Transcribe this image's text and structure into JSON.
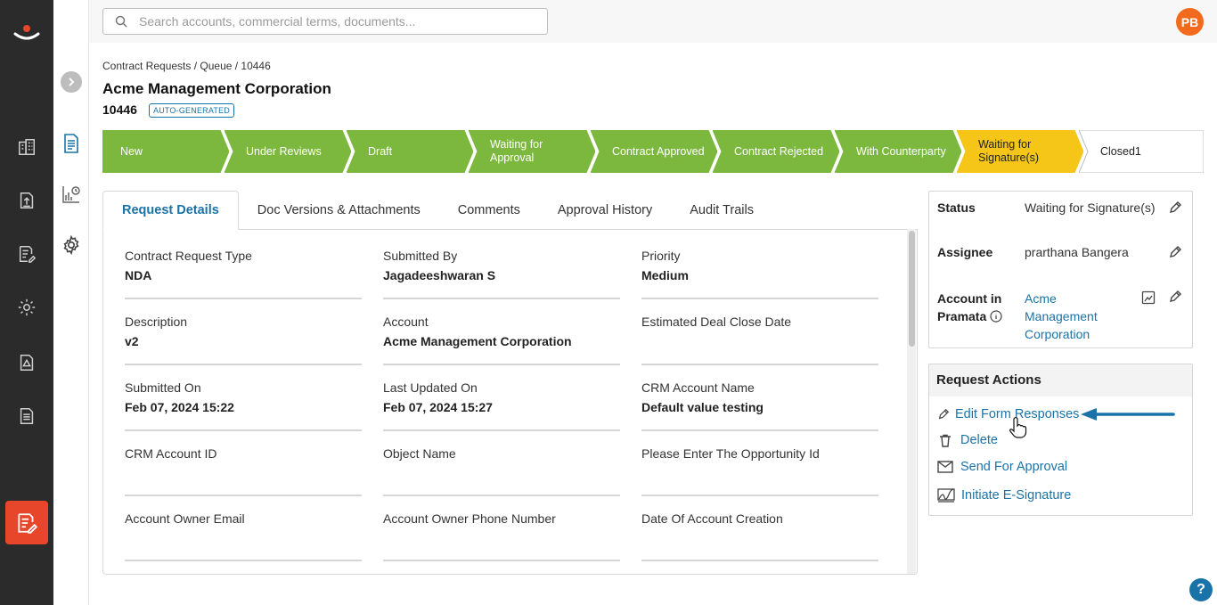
{
  "search": {
    "placeholder": "Search accounts, commercial terms, documents..."
  },
  "user": {
    "initials": "PB"
  },
  "breadcrumb": "Contract Requests / Queue / 10446",
  "header": {
    "title": "Acme Management Corporation",
    "id": "10446",
    "badge": "AUTO-GENERATED"
  },
  "stages": [
    {
      "label": "New",
      "state": "done"
    },
    {
      "label": "Under Reviews",
      "state": "done"
    },
    {
      "label": "Draft",
      "state": "done"
    },
    {
      "label": "Waiting for Approval",
      "state": "done"
    },
    {
      "label": "Contract Approved",
      "state": "done"
    },
    {
      "label": "Contract Rejected",
      "state": "done"
    },
    {
      "label": "With Counterparty",
      "state": "done"
    },
    {
      "label": "Waiting for Signature(s)",
      "state": "current"
    },
    {
      "label": "Closed1",
      "state": "pending"
    }
  ],
  "tabs": [
    "Request Details",
    "Doc Versions & Attachments",
    "Comments",
    "Approval History",
    "Audit Trails"
  ],
  "fields": [
    {
      "label": "Contract Request Type",
      "value": "NDA"
    },
    {
      "label": "Submitted By",
      "value": "Jagadeeshwaran S"
    },
    {
      "label": "Priority",
      "value": "Medium"
    },
    {
      "label": "Description",
      "value": "v2"
    },
    {
      "label": "Account",
      "value": "Acme Management Corporation"
    },
    {
      "label": "Estimated Deal Close Date",
      "value": ""
    },
    {
      "label": "Submitted On",
      "value": "Feb 07, 2024 15:22"
    },
    {
      "label": "Last Updated On",
      "value": "Feb 07, 2024 15:27"
    },
    {
      "label": "CRM Account Name",
      "value": "Default value testing"
    },
    {
      "label": "CRM Account ID",
      "value": ""
    },
    {
      "label": "Object Name",
      "value": ""
    },
    {
      "label": "Please Enter The Opportunity Id",
      "value": ""
    },
    {
      "label": "Account Owner Email",
      "value": ""
    },
    {
      "label": "Account Owner Phone Number",
      "value": ""
    },
    {
      "label": "Date Of Account Creation",
      "value": ""
    }
  ],
  "status_panel": {
    "status_label": "Status",
    "status_value": "Waiting for Signature(s)",
    "assignee_label": "Assignee",
    "assignee_value": "prarthana Bangera",
    "account_label_1": "Account in",
    "account_label_2": "Pramata",
    "account_value": "Acme Management Corporation"
  },
  "request_actions": {
    "title": "Request Actions",
    "items": [
      "Edit Form Responses",
      "Delete",
      "Send For Approval",
      "Initiate E-Signature"
    ]
  },
  "help": "?",
  "colors": {
    "done": "#7cb83e",
    "current": "#f5c518",
    "accent": "#1a73a8",
    "brand": "#e8462b",
    "avatar": "#f26b1d"
  }
}
